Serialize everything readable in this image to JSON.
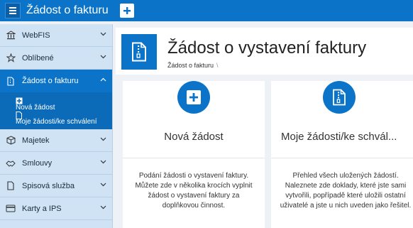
{
  "topbar": {
    "title": "Žádost o fakturu"
  },
  "sidebar": {
    "items": [
      {
        "label": "WebFIS"
      },
      {
        "label": "Oblíbené"
      },
      {
        "label": "Žádost o fakturu"
      },
      {
        "label": "Majetek"
      },
      {
        "label": "Smlouvy"
      },
      {
        "label": "Spisová služba"
      },
      {
        "label": "Karty a IPS"
      }
    ],
    "subitems": [
      {
        "label": "Nová žádost"
      },
      {
        "label": "Moje žádosti/ke schválení"
      }
    ]
  },
  "header": {
    "title": "Žádost o vystavení faktury",
    "breadcrumb": "Žádost o fakturu",
    "breadcrumb_sep": "\\"
  },
  "cards": [
    {
      "title": "Nová žádost",
      "description": "Podání žádosti o vystavení faktury. Můžete zde v několika krocích vyplnit žádost o vystavení faktury za doplňkovou činnost."
    },
    {
      "title": "Moje žádosti/ke schvál...",
      "description": "Přehled všech uložených žádostí. Naleznete zde doklady, které jste sami vytvořili, popřípadě které uložili ostatní uživatelé a jste u nich uveden jako řešitel."
    }
  ],
  "colors": {
    "accent": "#0b74c9",
    "sidebar_bg": "#cfe3f5"
  }
}
